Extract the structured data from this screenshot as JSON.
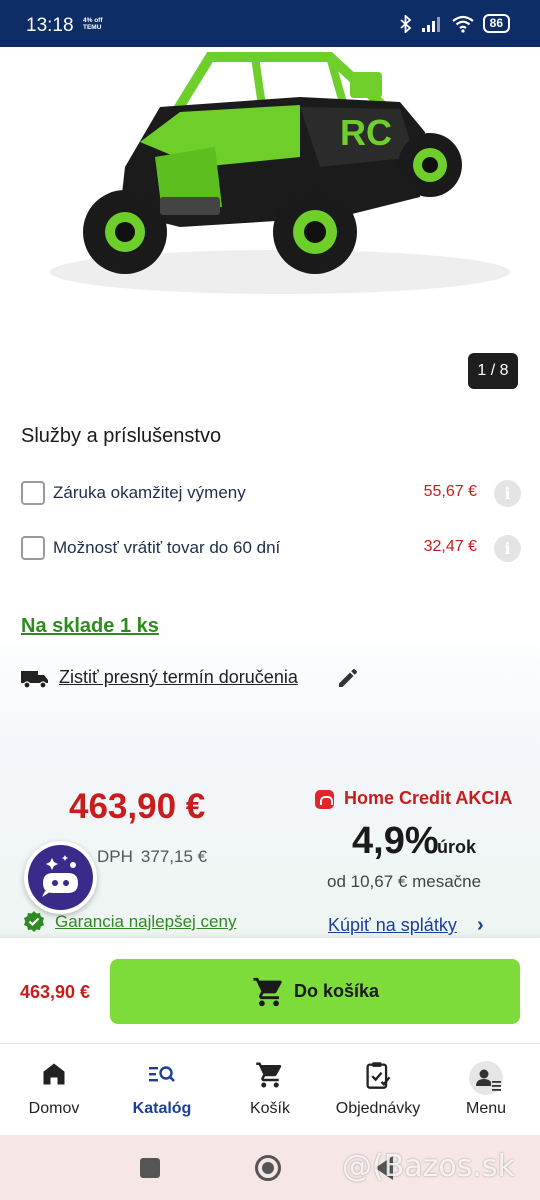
{
  "status_bar": {
    "time": "13:18",
    "temu_line1": "4% off",
    "temu_line2": "TEMU",
    "battery": "86"
  },
  "gallery": {
    "counter": "1 / 8"
  },
  "services": {
    "title": "Služby a príslušenstvo",
    "items": [
      {
        "label": "Záruka okamžitej výmeny",
        "price": "55,67 €",
        "checked": false
      },
      {
        "label": "Možnosť vrátiť tovar do 60 dní",
        "price": "32,47 €",
        "checked": false
      }
    ]
  },
  "availability": {
    "stock": "Na sklade 1 ks",
    "delivery_link": "Zistiť presný termín doručenia"
  },
  "pricing": {
    "price": "463,90 €",
    "vat_label": "DPH",
    "vat_value": "377,15 €",
    "guarantee": "Garancia najlepšej ceny"
  },
  "financing": {
    "title": "Home Credit AKCIA",
    "rate": "4,9%",
    "rate_label": "úrok",
    "monthly": "od 10,67 € mesačne",
    "cta": "Kúpiť na splátky"
  },
  "cart_bar": {
    "price": "463,90 €",
    "button_label": "Do košíka"
  },
  "bottom_nav": {
    "items": [
      {
        "label": "Domov",
        "icon": "home-icon",
        "active": false
      },
      {
        "label": "Katalóg",
        "icon": "catalog-search-icon",
        "active": true
      },
      {
        "label": "Košík",
        "icon": "cart-icon",
        "active": false
      },
      {
        "label": "Objednávky",
        "icon": "clipboard-check-icon",
        "active": false
      },
      {
        "label": "Menu",
        "icon": "user-menu-icon",
        "active": false
      }
    ]
  },
  "watermark": "@(Bazos.sk",
  "colors": {
    "status_bar": "#0e2d67",
    "price_red": "#c81d1d",
    "stock_green": "#2e8b1f",
    "cart_button": "#7ddb3a",
    "link_blue": "#1b3f9a"
  }
}
